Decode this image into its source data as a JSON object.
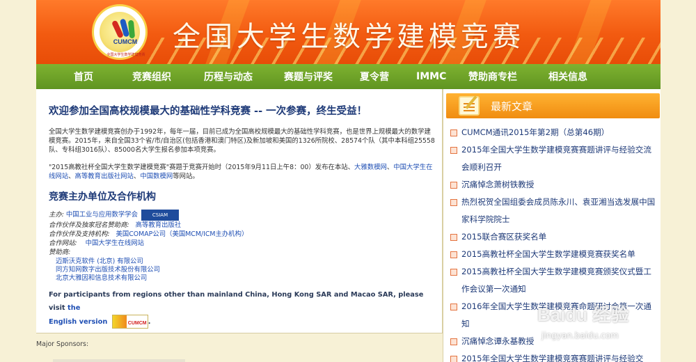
{
  "header": {
    "logo_text": "CUMCM",
    "logo_ring_text": "全国大学生数学建模竞赛",
    "site_title": "全国大学生数学建模竞赛"
  },
  "nav": {
    "items": [
      {
        "label": "首页"
      },
      {
        "label": "竞赛组织"
      },
      {
        "label": "历程与动态"
      },
      {
        "label": "赛题与评奖"
      },
      {
        "label": "夏令营"
      },
      {
        "label": "IMMC"
      },
      {
        "label": "赞助商专栏"
      },
      {
        "label": "相关信息"
      }
    ]
  },
  "main": {
    "welcome": "欢迎参加全国高校规模最大的基础性学科竞赛 -- 一次参赛，终生受益！",
    "intro": "全国大学生数学建模竞赛创办于1992年，每年一届，目前已成为全国高校规模最大的基础性学科竞赛，也是世界上规模最大的数学建模竞赛。2015年，来自全国33个省/市/自治区(包括香港和澳门特区)及新加坡和美国的1326所院校、28574个队（其中本科组25558队、专科组3016队）、85000名大学生报名参加本项竞赛。",
    "notice_pre": "\"2015高教社杯全国大学生数学建模竞赛\"赛题于竞赛开始时（2015年9月11日上午8：00）发布在本站、",
    "notice_link1": "大雅数模网",
    "notice_sep1": "、",
    "notice_link2": "中国大学生在线网站",
    "notice_sep2": "、",
    "notice_link3": "高等教育出版社网站",
    "notice_sep3": "、",
    "notice_link4": "中国数模网",
    "notice_post": "等网站。",
    "section_title": "竞赛主办单位及合作机构",
    "host_label": "主办:",
    "host_value": "中国工业与应用数学学会",
    "cstam_badge": "CSIAM",
    "partner1_label": "合作伙伴及独家冠名赞助商:",
    "partner1_value": "高等教育出版社",
    "partner2_label": "合作伙伴及支持机构:",
    "partner2_value": "美国COMAP公司（美国MCM/ICM主办机构）",
    "partner3_label": "合作网站:",
    "partner3_value": "中国大学生在线网站",
    "sponsors_label": "赞助商:",
    "sponsors": [
      "迈斯沃克软件 (北京) 有限公司",
      "同方知网数字出版技术股份有限公司",
      "北京大雅因和信息技术有限公司"
    ],
    "english_note": "For participants from regions other than mainland China, Hong Kong SAR and Macao SAR, please visit",
    "english_link_a": "the",
    "english_link_b": "English version",
    "english_badge": "CUMCM",
    "english_end": "."
  },
  "footer": {
    "major_sponsors": "Major Sponsors:"
  },
  "sidebar": {
    "title": "最新文章",
    "news": [
      "CUMCM通讯2015年第2期（总第46期）",
      "2015年全国大学生数学建模竞赛赛题讲评与经验交流会顺利召开",
      "沉痛悼念萧树铁教授",
      "热烈祝贺全国组委会成员陈永川、袁亚湘当选发展中国家科学院院士",
      "2015联合赛区获奖名单",
      "2015高教社杯全国大学生数学建模竞赛获奖名单",
      "2015高教社杯全国大学生数学建模竞赛颁奖仪式暨工作会议第一次通知",
      "2016年全国大学生数学建模竞赛命题研讨会第一次通知",
      "沉痛悼念谭永基教授",
      "2015年全国大学生数学建模竞赛赛题讲评与经验交"
    ]
  },
  "watermark": {
    "brand": "Baidu 经验",
    "url": "jingyan.baidu.com"
  }
}
